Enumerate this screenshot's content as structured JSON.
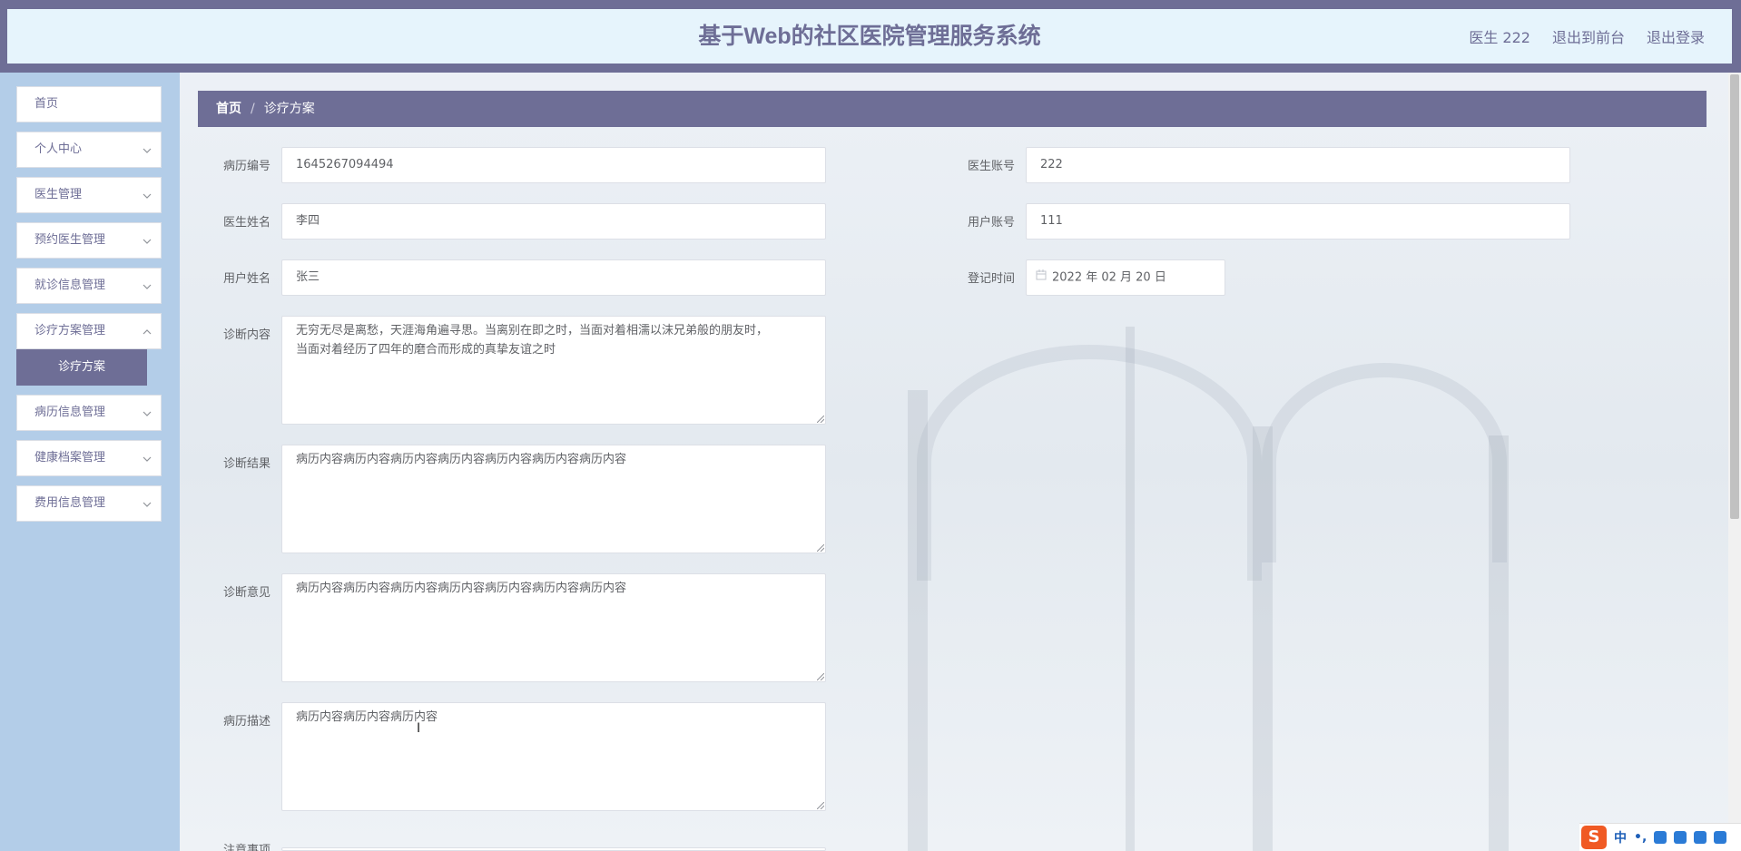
{
  "header": {
    "title": "基于Web的社区医院管理服务系统",
    "user_label": "医生 222",
    "front_link": "退出到前台",
    "logout_link": "退出登录"
  },
  "sidebar": {
    "items": [
      {
        "label": "首页"
      },
      {
        "label": "个人中心"
      },
      {
        "label": "医生管理"
      },
      {
        "label": "预约医生管理"
      },
      {
        "label": "就诊信息管理"
      },
      {
        "label": "诊疗方案管理"
      },
      {
        "label": "病历信息管理"
      },
      {
        "label": "健康档案管理"
      },
      {
        "label": "费用信息管理"
      }
    ],
    "active_sub": "诊疗方案"
  },
  "breadcrumb": {
    "home": "首页",
    "separator": "/",
    "current": "诊疗方案"
  },
  "form": {
    "record_no_label": "病历编号",
    "record_no": "1645267094494",
    "doctor_account_label": "医生账号",
    "doctor_account": "222",
    "doctor_name_label": "医生姓名",
    "doctor_name": "李四",
    "user_account_label": "用户账号",
    "user_account": "111",
    "user_name_label": "用户姓名",
    "user_name": "张三",
    "register_time_label": "登记时间",
    "register_time": "2022 年 02 月 20 日",
    "diagnosis_content_label": "诊断内容",
    "diagnosis_content_line1": "无穷无尽是离愁，天涯海角遍寻思。当离别在即之时，当面对着相濡以沫兄弟般的朋友时，",
    "diagnosis_content_line2": "当面对着经历了四年的磨合而形成的真挚友谊之时",
    "diagnosis_result_label": "诊断结果",
    "diagnosis_result": "病历内容病历内容病历内容病历内容病历内容病历内容病历内容",
    "diagnosis_opinion_label": "诊断意见",
    "diagnosis_opinion": "病历内容病历内容病历内容病历内容病历内容病历内容病历内容",
    "record_desc_label": "病历描述",
    "record_desc": "病历内容病历内容病历内容",
    "notes_label": "注意事项"
  },
  "ime": {
    "logo": "S",
    "lang": "中",
    "punct": "•,"
  },
  "colors": {
    "accent": "#6e6e96",
    "header_bg": "#e6f4fc",
    "sidebar_bg": "#b3cde8"
  }
}
